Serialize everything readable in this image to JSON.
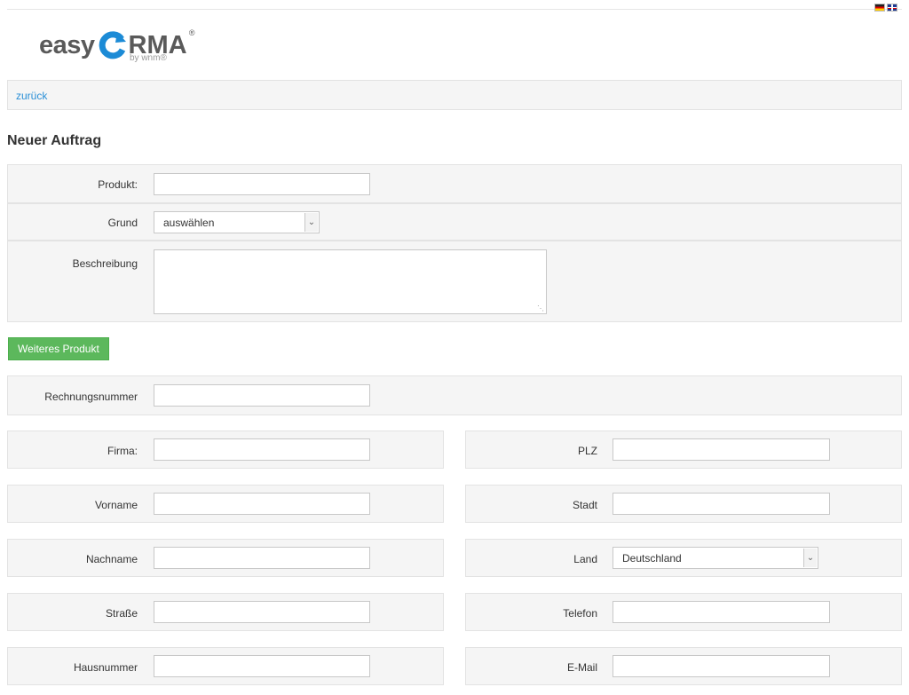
{
  "header": {
    "logo": {
      "easy": "easy",
      "rma": "RMA",
      "reg": "®",
      "by": "by wnm®"
    },
    "languages": [
      {
        "icon": "flag-de-icon"
      },
      {
        "icon": "flag-uk-icon"
      }
    ]
  },
  "nav": {
    "back_label": "zurück"
  },
  "page": {
    "title": "Neuer Auftrag"
  },
  "product": {
    "produkt_label": "Produkt:",
    "produkt_value": "",
    "grund_label": "Grund",
    "grund_selected": "auswählen",
    "beschreibung_label": "Beschreibung",
    "beschreibung_value": ""
  },
  "actions": {
    "weiteres_produkt": "Weiteres Produkt"
  },
  "invoice": {
    "rechnungsnummer_label": "Rechnungsnummer",
    "rechnungsnummer_value": ""
  },
  "address_left": {
    "firma_label": "Firma:",
    "vorname_label": "Vorname",
    "nachname_label": "Nachname",
    "strasse_label": "Straße",
    "hausnummer_label": "Hausnummer"
  },
  "address_right": {
    "plz_label": "PLZ",
    "stadt_label": "Stadt",
    "land_label": "Land",
    "land_selected": "Deutschland",
    "telefon_label": "Telefon",
    "email_label": "E-Mail"
  },
  "colors": {
    "accent_link": "#2a8fd6",
    "button_green": "#5cb85c",
    "row_bg": "#f5f5f5",
    "logo_blue": "#1c8bd6"
  }
}
